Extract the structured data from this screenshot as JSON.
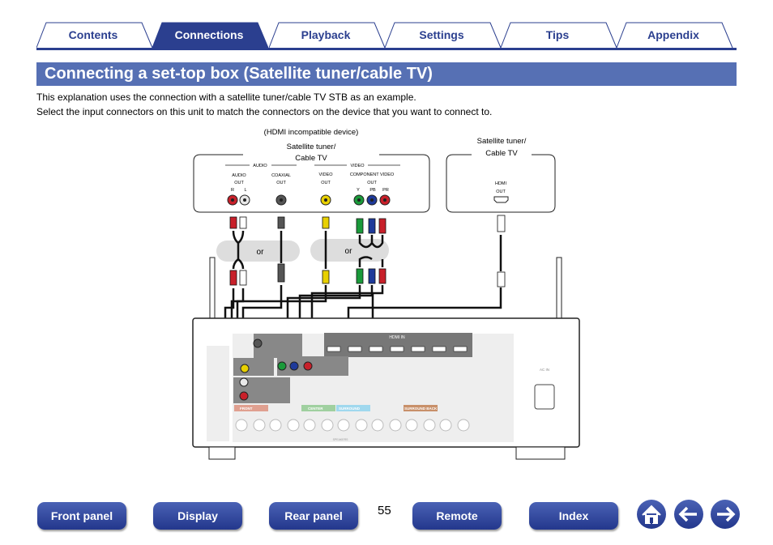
{
  "tabs": [
    {
      "label": "Contents",
      "active": false
    },
    {
      "label": "Connections",
      "active": true
    },
    {
      "label": "Playback",
      "active": false
    },
    {
      "label": "Settings",
      "active": false
    },
    {
      "label": "Tips",
      "active": false
    },
    {
      "label": "Appendix",
      "active": false
    }
  ],
  "title": "Connecting a set-top box (Satellite tuner/cable TV)",
  "body": [
    "This explanation uses the connection with a satellite tuner/cable TV STB as an example.",
    "Select the input connectors on this unit to match the connectors on the device that you want to connect to."
  ],
  "diagram": {
    "left_device": {
      "note": "(HDMI incompatible device)",
      "name_line1": "Satellite tuner/",
      "name_line2": "Cable TV",
      "audio_group": "AUDIO",
      "video_group": "VIDEO",
      "audio_out_1": "AUDIO",
      "audio_out_2": "OUT",
      "r": "R",
      "l": "L",
      "coaxial_1": "COAXIAL",
      "coaxial_2": "OUT",
      "video_out_1": "VIDEO",
      "video_out_2": "OUT",
      "component_1": "COMPONENT VIDEO",
      "component_2": "OUT",
      "y": "Y",
      "pb": "PB",
      "pr": "PR"
    },
    "right_device": {
      "name_line1": "Satellite tuner/",
      "name_line2": "Cable TV",
      "hdmi_1": "HDMI",
      "hdmi_2": "OUT"
    },
    "or_1": "or",
    "or_2": "or",
    "receiver": {
      "hdmi_in": "HDMI IN",
      "ac_in": "AC IN",
      "speakers": "SPEAKERS",
      "front": "FRONT",
      "center": "CENTER",
      "surround": "SURROUND",
      "surround_back": "SURROUND BACK"
    },
    "colors": {
      "red": "#c8202a",
      "white": "#e8e8e8",
      "black": "#333333",
      "yellow": "#e8d000",
      "green": "#1a9a3a",
      "blue": "#1e3a9a"
    }
  },
  "footer": {
    "buttons": [
      "Front panel",
      "Display",
      "Rear panel",
      "Remote",
      "Index"
    ],
    "page_number": "55",
    "icons": [
      "home-icon",
      "back-arrow-icon",
      "forward-arrow-icon"
    ]
  }
}
